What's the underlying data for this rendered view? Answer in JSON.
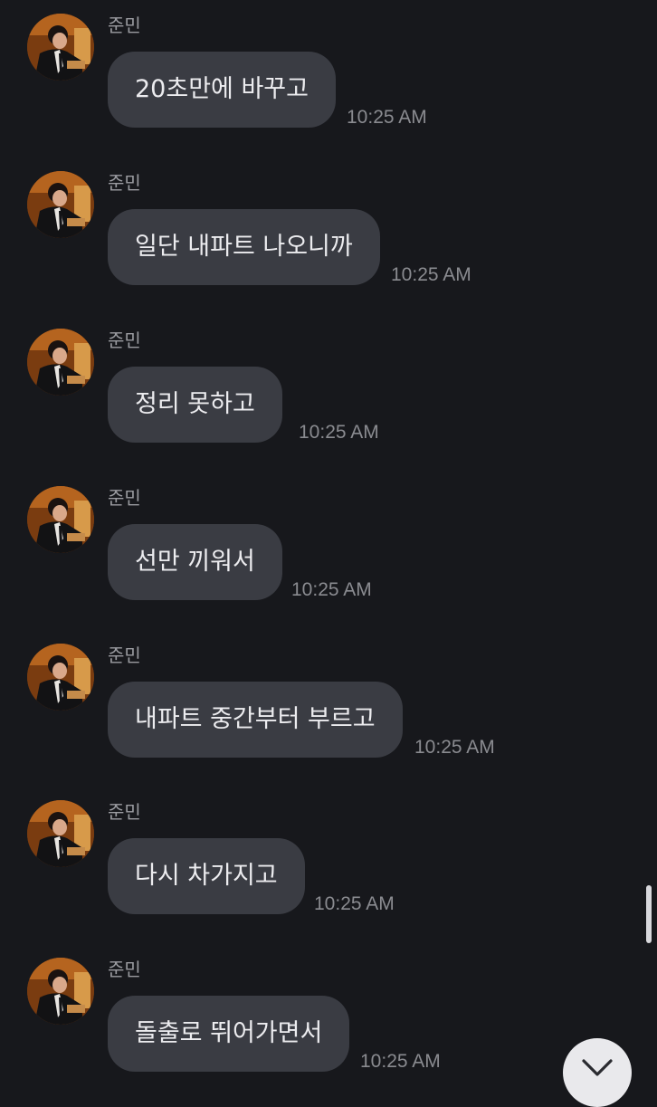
{
  "conversation": {
    "messages": [
      {
        "sender": "준민",
        "text": "20초만에 바꾸고",
        "time": "10:25 AM"
      },
      {
        "sender": "준민",
        "text": "일단 내파트 나오니까",
        "time": "10:25 AM"
      },
      {
        "sender": "준민",
        "text": "정리 못하고",
        "time": "10:25 AM"
      },
      {
        "sender": "준민",
        "text": "선만 끼워서",
        "time": "10:25 AM"
      },
      {
        "sender": "준민",
        "text": "내파트 중간부터 부르고",
        "time": "10:25 AM"
      },
      {
        "sender": "준민",
        "text": "다시 차가지고",
        "time": "10:25 AM"
      },
      {
        "sender": "준민",
        "text": "돌출로 뛰어가면서",
        "time": "10:25 AM"
      }
    ]
  },
  "icons": {
    "scroll_to_bottom": "chevron-down-icon",
    "avatar": "profile-avatar"
  }
}
